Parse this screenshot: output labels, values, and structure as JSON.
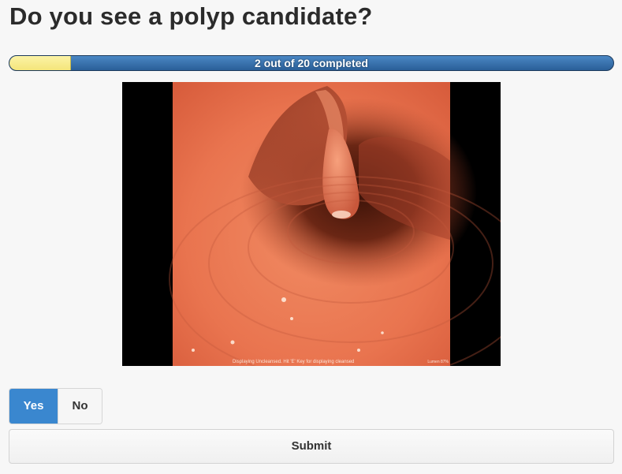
{
  "question": {
    "title": "Do you see a polyp candidate?"
  },
  "progress": {
    "completed": 2,
    "total": 20,
    "fraction": 0.1,
    "label": "2 out of 20 completed",
    "fill_color": "#f6ea8a",
    "track_color": "#336ea8"
  },
  "viewer": {
    "caption": "Displaying Uncleansed. Hit 'E' Key for displaying cleansed",
    "lumen_label": "Lumen 87%"
  },
  "answer": {
    "options": [
      {
        "label": "Yes",
        "selected": true
      },
      {
        "label": "No",
        "selected": false
      }
    ],
    "selected_color": "#3a87cf"
  },
  "submit": {
    "label": "Submit"
  }
}
